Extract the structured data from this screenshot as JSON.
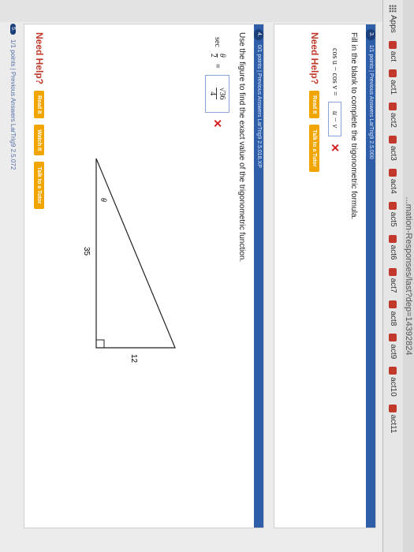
{
  "browser": {
    "url": "...mation-Responses/last?dep=14392824",
    "apps_label": "Apps",
    "bookmarks": [
      "act",
      "act1",
      "act2",
      "act3",
      "act4",
      "act5",
      "act6",
      "act7",
      "act8",
      "act9",
      "act10",
      "act11"
    ]
  },
  "question3": {
    "number": "3.",
    "header": "1/1 points | Previous Answers LarTrig9 2.5.000",
    "prompt": "Fill in the blank to complete the trigonometric formula.",
    "formula_left": "cos u − cos v =",
    "answer": "u − v",
    "help_label": "Need Help?",
    "buttons": [
      "Read It",
      "Talk to a Tutor"
    ]
  },
  "question4": {
    "number": "4.",
    "header": "0/1 points | Previous Answers LarTrig9 2.5.018.XP",
    "prompt": "Use the figure to find the exact value of the trigonometric function.",
    "function_prefix": "sec",
    "func_num": "θ",
    "func_den": "2",
    "equals": "=",
    "ans_num": "√36",
    "ans_den": "4",
    "help_label": "Need Help?",
    "buttons": [
      "Read It",
      "Watch It",
      "Talk to a Tutor"
    ],
    "figure": {
      "angle_label": "θ",
      "side_vertical": "12",
      "side_horizontal": "35"
    }
  },
  "question5": {
    "number": "5.",
    "header": "1/1 points | Previous Answers LarTrig9 2.5.072"
  },
  "colors": {
    "header_blue": "#2f5fa8",
    "error_red": "#d62020",
    "help_red": "#c0392b",
    "button_orange": "#f0a500"
  }
}
